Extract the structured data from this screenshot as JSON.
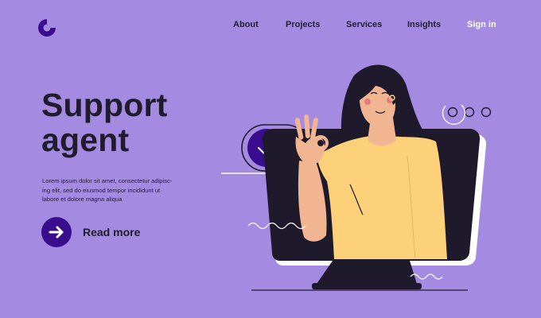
{
  "brand": {
    "logo_icon": "c-ring-logo-icon",
    "color": "#3a0d8f"
  },
  "nav": {
    "about": "About",
    "projects": "Projects",
    "services": "Services",
    "insights": "Insights",
    "sign_in": "Sign in"
  },
  "hero": {
    "title_line1": "Support",
    "title_line2": "agent",
    "description_line1": "Lorem ipsum dolor sit amet, consectetur adipisc-",
    "description_line2": "ing elit, sed do eiusmod tempor incididunt ut",
    "description_line3": "labore et dolore magna aliqua",
    "cta_label": "Read more",
    "cta_icon": "arrow-right-icon"
  },
  "colors": {
    "background": "#a48ae0",
    "accent": "#3a0d8f",
    "dark": "#1f1b2e",
    "shirt": "#fdd17a",
    "skin": "#f2b592"
  }
}
